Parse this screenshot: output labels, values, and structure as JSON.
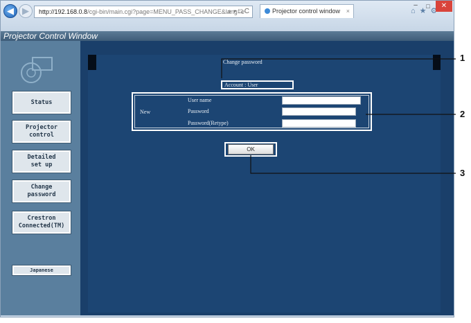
{
  "browser": {
    "address_host": "http://192.168.0.8",
    "address_path": "/cgi-bin/main.cgi?page=MENU_PASS_CHANGE&lang=e",
    "address_tools": "⌕ ▾ □ C",
    "tab_title": "Projector control window",
    "tab_close": "×",
    "toolbar_icons": "⌂★⚙",
    "window_min": "–",
    "window_max": "□",
    "window_close": "✕"
  },
  "app": {
    "title": "Projector Control Window"
  },
  "sidebar": {
    "items": [
      {
        "label": "Status"
      },
      {
        "label": "Projector\ncontrol"
      },
      {
        "label": "Detailed\nset up"
      },
      {
        "label": "Change\npassword"
      },
      {
        "label": "Crestron\nConnected(TM)"
      }
    ],
    "language": "Japanese"
  },
  "page": {
    "heading": "Change password",
    "account": "Account : User",
    "group_label": "New",
    "fields": [
      {
        "label": "User name",
        "value": ""
      },
      {
        "label": "Password",
        "value": ""
      },
      {
        "label": "Password(Retype)",
        "value": ""
      }
    ],
    "ok_label": "OK"
  },
  "callouts": [
    "1",
    "2",
    "3"
  ],
  "colors": {
    "sidebar": "#5a7f9e",
    "content_bg": "#1c4573",
    "title_bar": "#3e5c78"
  }
}
